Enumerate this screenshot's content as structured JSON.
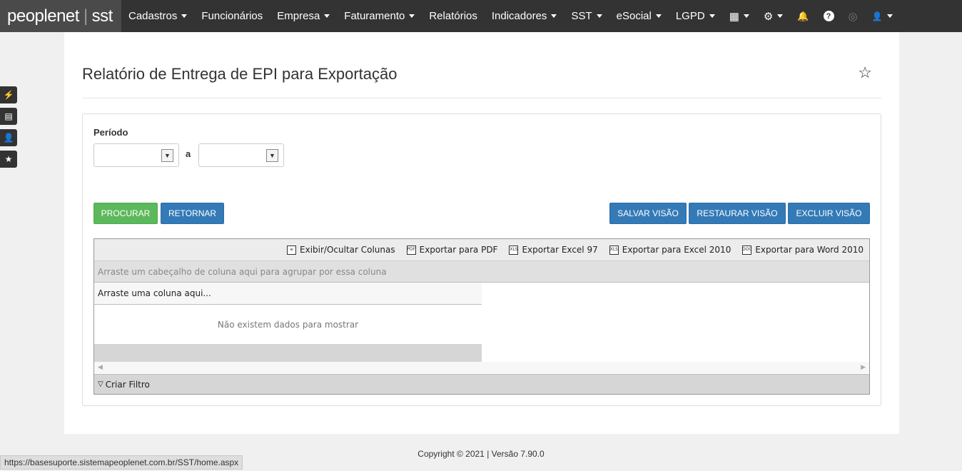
{
  "navbar": {
    "brand_left": "peoplenet",
    "brand_sep": "|",
    "brand_right": "sst",
    "items": [
      {
        "label": "Cadastros",
        "dropdown": true
      },
      {
        "label": "Funcionários",
        "dropdown": false
      },
      {
        "label": "Empresa",
        "dropdown": true
      },
      {
        "label": "Faturamento",
        "dropdown": true
      },
      {
        "label": "Relatórios",
        "dropdown": false
      },
      {
        "label": "Indicadores",
        "dropdown": true
      },
      {
        "label": "SST",
        "dropdown": true
      },
      {
        "label": "eSocial",
        "dropdown": true
      },
      {
        "label": "LGPD",
        "dropdown": true
      }
    ],
    "icons": {
      "calendar": "▦",
      "gear": "⚙",
      "bell": "🔔",
      "help": "?",
      "fingerprint": "◎",
      "user": "👤"
    }
  },
  "left_icons": {
    "bolt": "⚡",
    "clipboard": "▤",
    "user": "👤",
    "star": "★"
  },
  "page": {
    "title": "Relatório de Entrega de EPI para Exportação",
    "star_icon": "☆"
  },
  "form": {
    "periodo_label": "Período",
    "a_label": "a",
    "date_from": "",
    "date_to": ""
  },
  "buttons": {
    "procurar": "PROCURAR",
    "retornar": "RETORNAR",
    "salvar_visao": "SALVAR VISÃO",
    "restaurar_visao": "RESTAURAR VISÃO",
    "excluir_visao": "EXCLUIR VISÃO"
  },
  "grid": {
    "toolbar": {
      "columns": "Exibir/Ocultar Colunas",
      "pdf": "Exportar para PDF",
      "excel97": "Exportar Excel 97",
      "excel2010": "Exportar para Excel 2010",
      "word2010": "Exportar para Word 2010"
    },
    "group_panel": "Arraste um cabeçalho de coluna aqui para agrupar por essa coluna",
    "column_drop": "Arraste uma coluna aqui...",
    "no_data": "Não existem dados para mostrar",
    "filter": "Criar Filtro"
  },
  "footer": {
    "copyright": "Copyright © 2021 | Versão 7.90.0"
  },
  "statusbar": {
    "url": "https://basesuporte.sistemapeoplenet.com.br/SST/home.aspx"
  }
}
